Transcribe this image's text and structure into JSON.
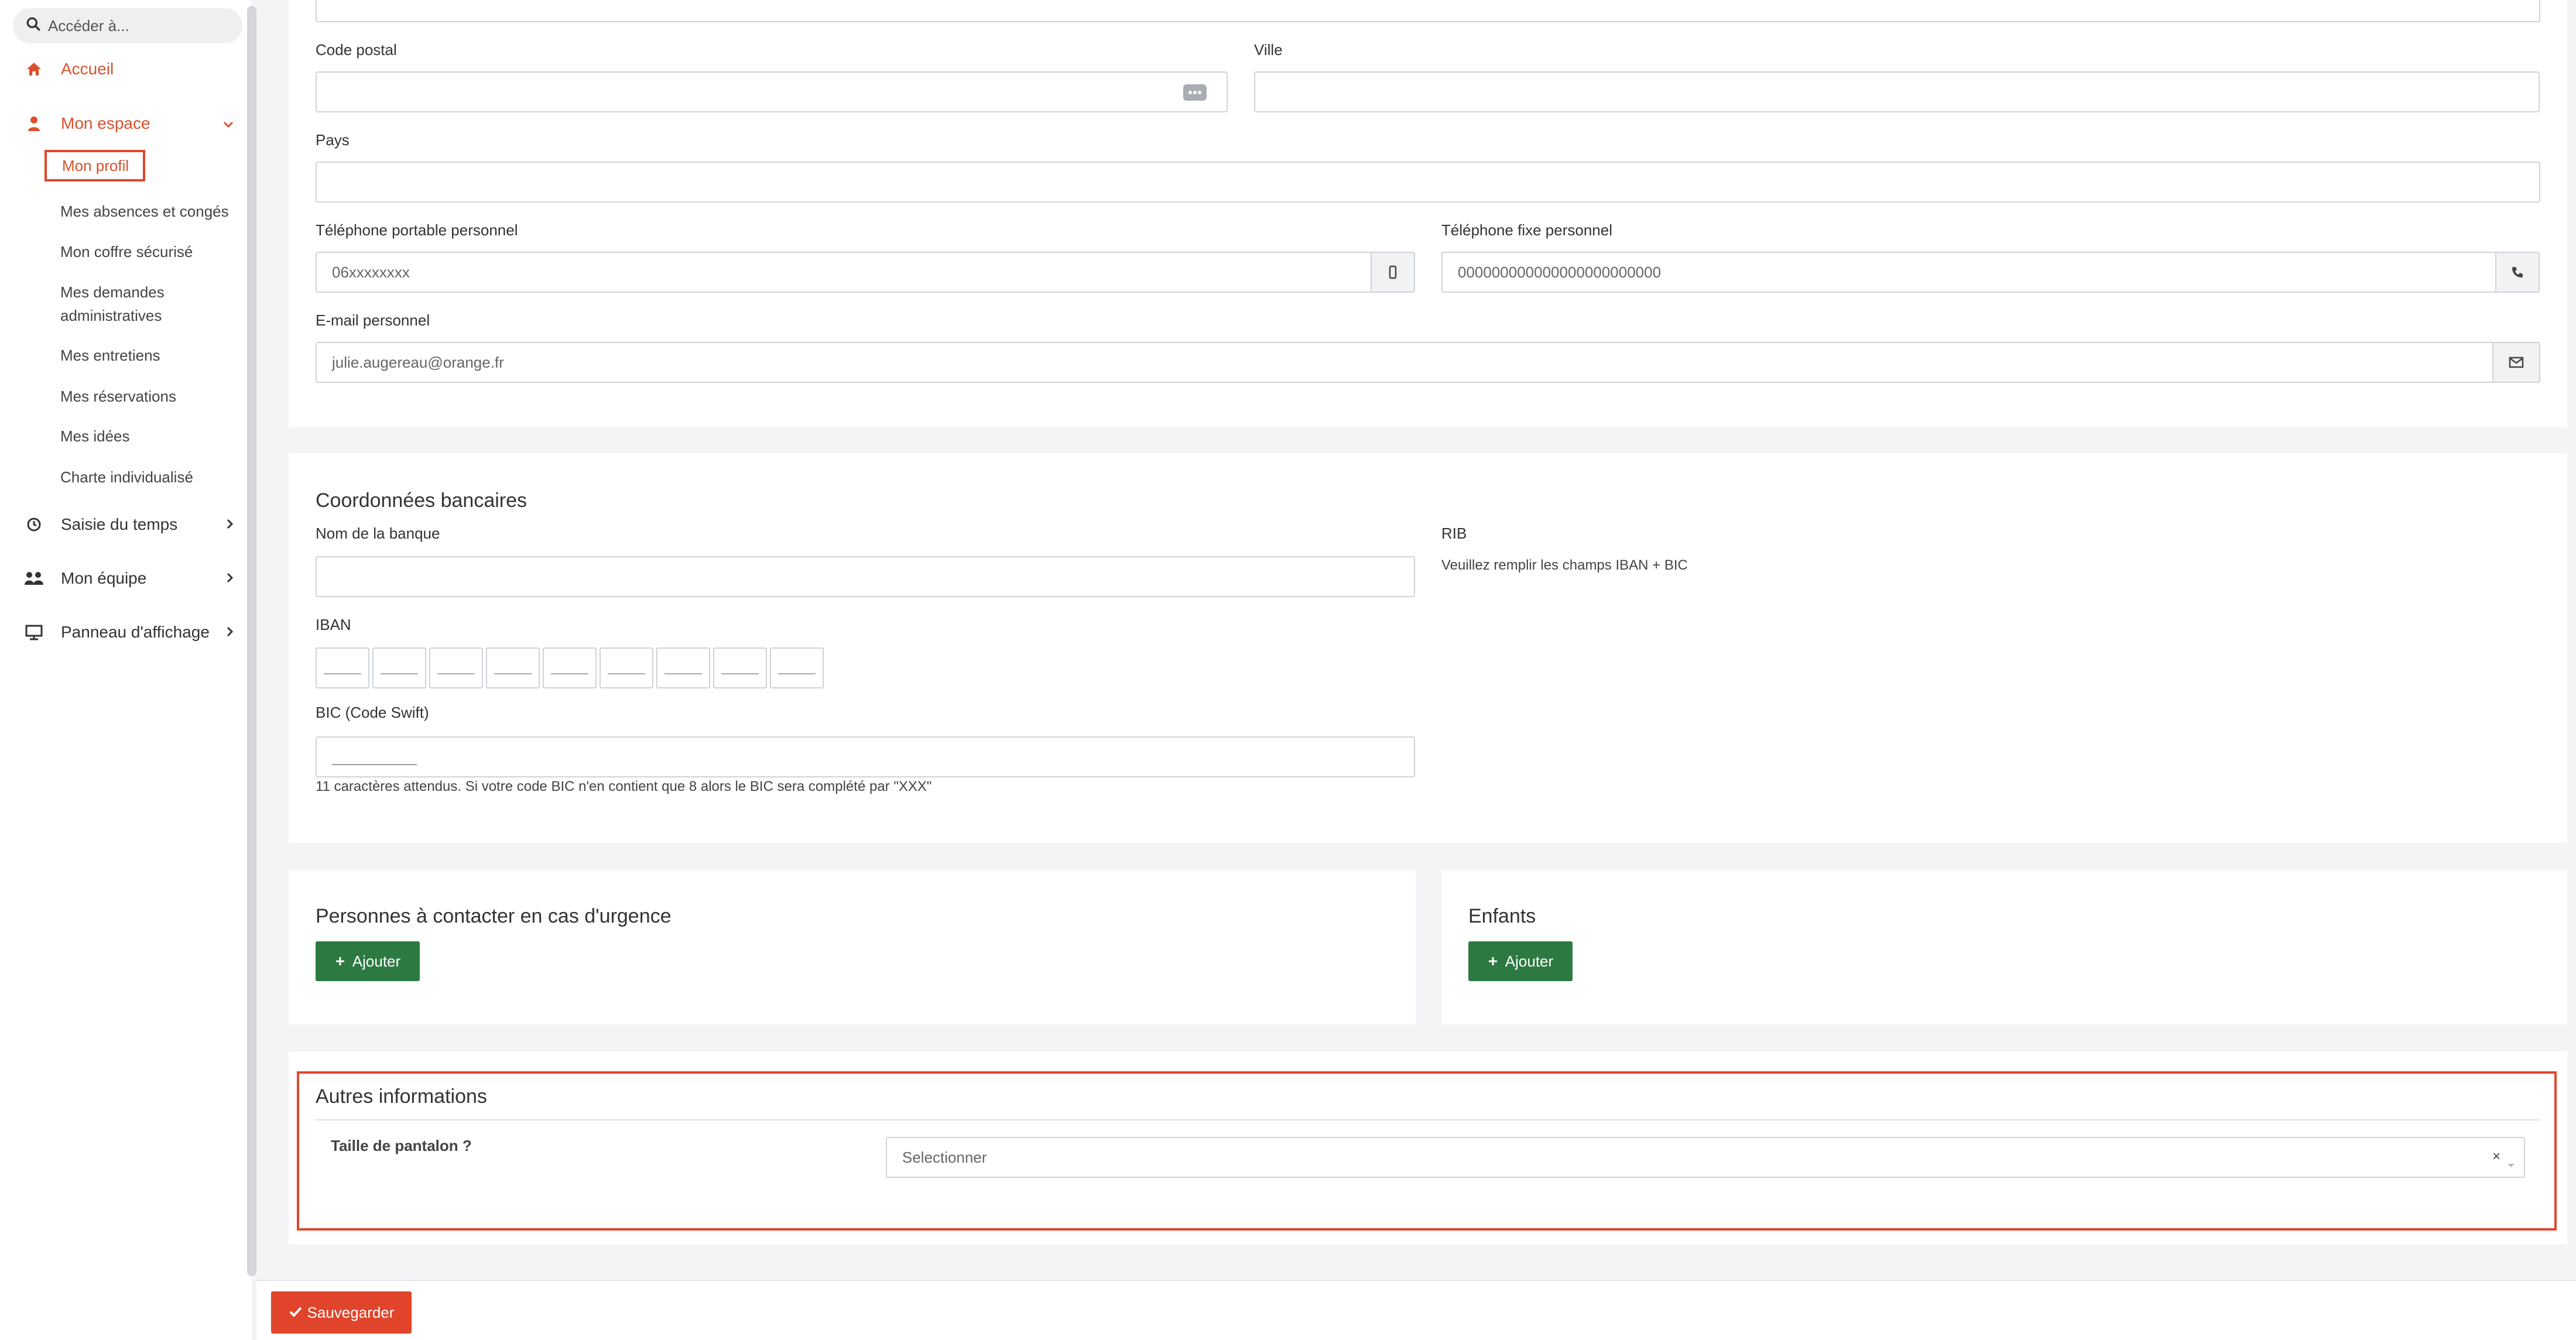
{
  "sidebar": {
    "search_placeholder": "Accéder à...",
    "home": "Accueil",
    "my_space": "Mon espace",
    "sub_items": [
      "Mon profil",
      "Mes absences et congés",
      "Mon coffre sécurisé",
      "Mes demandes",
      "administratives",
      "Mes entretiens",
      "Mes réservations",
      "Mes idées",
      "Charte individualisé"
    ],
    "time_entry": "Saisie du temps",
    "my_team": "Mon équipe",
    "board": "Panneau d'affichage"
  },
  "address": {
    "postal_code_label": "Code postal",
    "city_label": "Ville",
    "country_label": "Pays",
    "mobile_label": "Téléphone portable personnel",
    "mobile_value": "06xxxxxxxx",
    "landline_label": "Téléphone fixe personnel",
    "landline_value": "000000000000000000000000",
    "email_label": "E-mail personnel",
    "email_value": "julie.augereau@orange.fr"
  },
  "bank": {
    "title": "Coordonnées bancaires",
    "bank_name_label": "Nom de la banque",
    "rib_label": "RIB",
    "rib_hint": "Veuillez remplir les champs IBAN + BIC",
    "iban_label": "IBAN",
    "bic_label": "BIC (Code Swift)",
    "bic_placeholder": "__________",
    "bic_hint": "11 caractères attendus. Si votre code BIC n'en contient que 8 alors le BIC sera complété par \"XXX\""
  },
  "emergency": {
    "title": "Personnes à contacter en cas d'urgence",
    "add": "Ajouter"
  },
  "children": {
    "title": "Enfants",
    "add": "Ajouter"
  },
  "other": {
    "title": "Autres informations",
    "pants_label": "Taille de pantalon ?",
    "select_placeholder": "Selectionner",
    "clear": "×"
  },
  "save_label": "Sauvegarder",
  "colors": {
    "accent": "#d9512c",
    "highlight_border": "#e0462b",
    "green_button": "#2c7a42",
    "save_button": "#e0442a"
  },
  "icons": [
    "search-icon",
    "home-icon",
    "user-icon",
    "chevron-down-icon",
    "chevron-right-icon",
    "clock-icon",
    "team-icon",
    "board-icon",
    "dots-icon",
    "mobile-icon",
    "phone-icon",
    "envelope-icon",
    "plus-icon",
    "check-icon"
  ]
}
